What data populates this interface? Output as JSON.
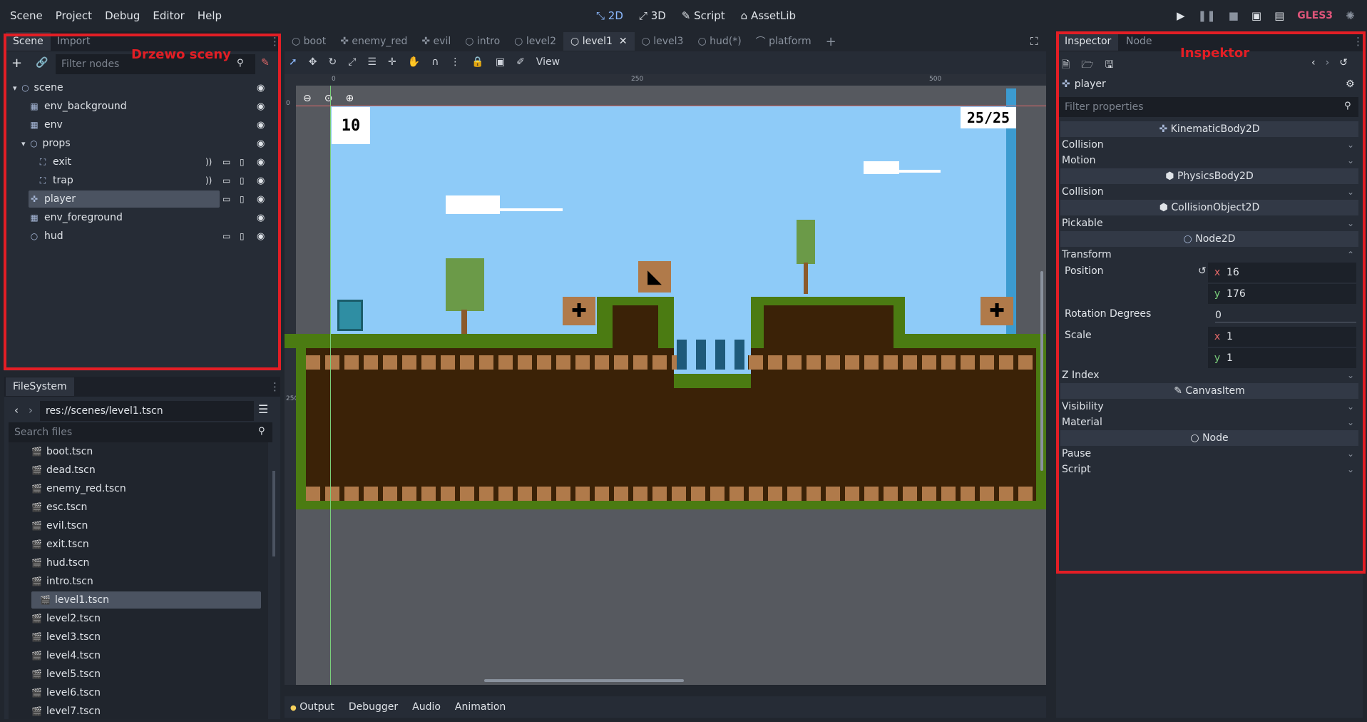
{
  "menu": [
    "Scene",
    "Project",
    "Debug",
    "Editor",
    "Help"
  ],
  "workspaces": {
    "w2d": "2D",
    "w3d": "3D",
    "script": "Script",
    "assetlib": "AssetLib"
  },
  "renderer": "GLES3",
  "scene_dock": {
    "tabs": [
      "Scene",
      "Import"
    ],
    "label": "Drzewo sceny",
    "filter_placeholder": "Filter nodes",
    "nodes": [
      {
        "name": "scene",
        "depth": 0,
        "icon": "node2d-icon"
      },
      {
        "name": "env_background",
        "depth": 1,
        "icon": "tilemap-icon"
      },
      {
        "name": "env",
        "depth": 1,
        "icon": "tilemap-icon"
      },
      {
        "name": "props",
        "depth": 1,
        "icon": "node2d-icon"
      },
      {
        "name": "exit",
        "depth": 2,
        "icon": "area2d-icon"
      },
      {
        "name": "trap",
        "depth": 2,
        "icon": "area2d-icon"
      },
      {
        "name": "player",
        "depth": 1,
        "icon": "kinematic-body-icon",
        "selected": true
      },
      {
        "name": "env_foreground",
        "depth": 1,
        "icon": "tilemap-icon"
      },
      {
        "name": "hud",
        "depth": 1,
        "icon": "node2d-icon"
      }
    ]
  },
  "filesystem": {
    "title": "FileSystem",
    "path": "res://scenes/level1.tscn",
    "search_placeholder": "Search files",
    "files": [
      "boot.tscn",
      "dead.tscn",
      "enemy_red.tscn",
      "esc.tscn",
      "evil.tscn",
      "exit.tscn",
      "hud.tscn",
      "intro.tscn",
      "level1.tscn",
      "level2.tscn",
      "level3.tscn",
      "level4.tscn",
      "level5.tscn",
      "level6.tscn",
      "level7.tscn"
    ],
    "selected": "level1.tscn"
  },
  "scene_tabs": [
    "boot",
    "enemy_red",
    "evil",
    "intro",
    "level2",
    "level1",
    "level3",
    "hud(*)",
    "platform"
  ],
  "active_scene_tab": "level1",
  "viewport": {
    "view_menu": "View",
    "ruler_marks": [
      "0",
      "250",
      "500"
    ],
    "vruler_marks": [
      "0",
      "250"
    ],
    "hud_left": "10",
    "hud_right": "25/25"
  },
  "bottom_tabs": [
    "Output",
    "Debugger",
    "Audio",
    "Animation"
  ],
  "inspector": {
    "tabs": [
      "Inspector",
      "Node"
    ],
    "label": "Inspektor",
    "node_name": "player",
    "filter_placeholder": "Filter properties",
    "sections": {
      "kinematic": "KinematicBody2D",
      "physics": "PhysicsBody2D",
      "collision_object": "CollisionObject2D",
      "node2d": "Node2D",
      "canvas_item": "CanvasItem",
      "node": "Node"
    },
    "props": {
      "collision": "Collision",
      "motion": "Motion",
      "collision2": "Collision",
      "pickable": "Pickable",
      "transform": "Transform",
      "position": "Position",
      "rotation": "Rotation Degrees",
      "scale": "Scale",
      "z_index": "Z Index",
      "visibility": "Visibility",
      "material": "Material",
      "pause": "Pause",
      "script": "Script"
    },
    "values": {
      "pos_x": "16",
      "pos_y": "176",
      "rotation": "0",
      "scale_x": "1",
      "scale_y": "1",
      "axis_x": "x",
      "axis_y": "y"
    }
  }
}
